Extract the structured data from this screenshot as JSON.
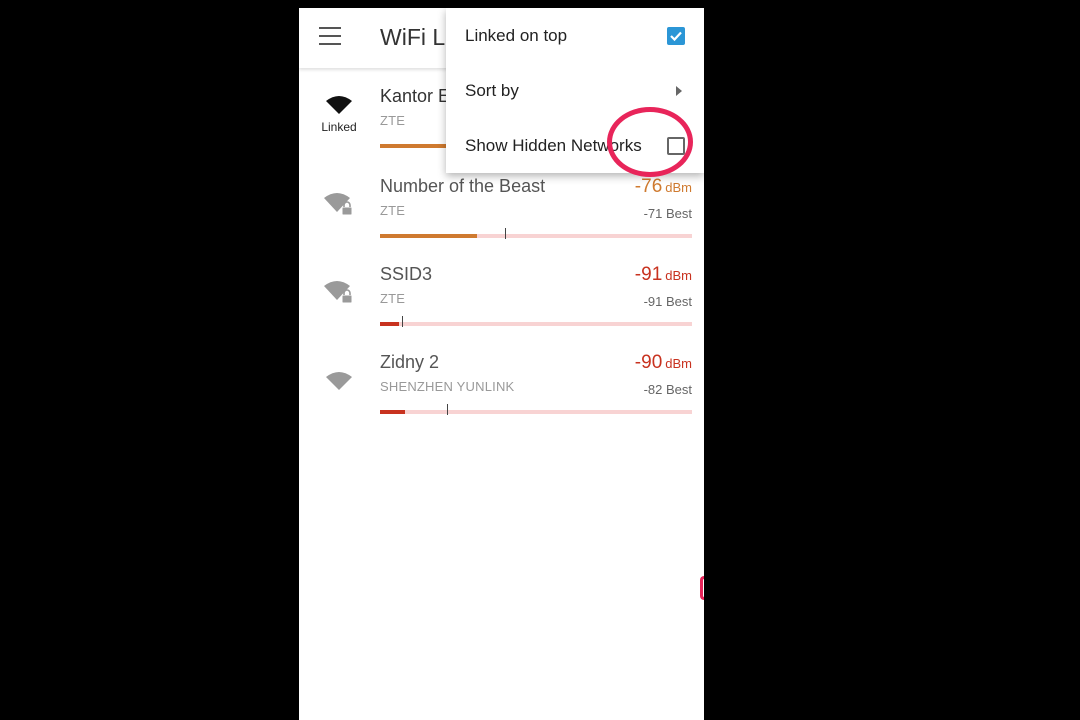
{
  "app": {
    "title": "WiFi Li"
  },
  "networks": [
    {
      "ssid": "Kantor E",
      "vendor": "ZTE",
      "status_label": "Linked",
      "icon": "wifi-full-icon",
      "color": "#cf7a2f"
    },
    {
      "ssid": "Number of the Beast",
      "vendor": "ZTE",
      "dbm": "-76",
      "unit": "dBm",
      "best": "-71 Best",
      "icon": "wifi-locked-icon",
      "color": "#cf7a2f",
      "signal_fraction": 0.31,
      "best_fraction": 0.4
    },
    {
      "ssid": "SSID3",
      "vendor": "ZTE",
      "dbm": "-91",
      "unit": "dBm",
      "best": "-91 Best",
      "icon": "wifi-locked-icon",
      "color": "#c8321f",
      "signal_fraction": 0.06,
      "best_fraction": 0.07
    },
    {
      "ssid": "Zidny 2",
      "vendor": "SHENZHEN YUNLINK",
      "dbm": "-90",
      "unit": "dBm",
      "best": "-82 Best",
      "icon": "wifi-icon",
      "color": "#c8321f",
      "signal_fraction": 0.08,
      "best_fraction": 0.215
    }
  ],
  "menu": {
    "items": [
      {
        "label": "Linked on top",
        "control": "checkbox",
        "checked": true
      },
      {
        "label": "Sort by",
        "control": "submenu-arrow"
      },
      {
        "label": "Show Hidden Networks",
        "control": "checkbox",
        "checked": false
      }
    ]
  },
  "colors": {
    "accent": "#2b96d6",
    "highlight": "#e8255a",
    "bar_track": "#f8d3d3"
  }
}
